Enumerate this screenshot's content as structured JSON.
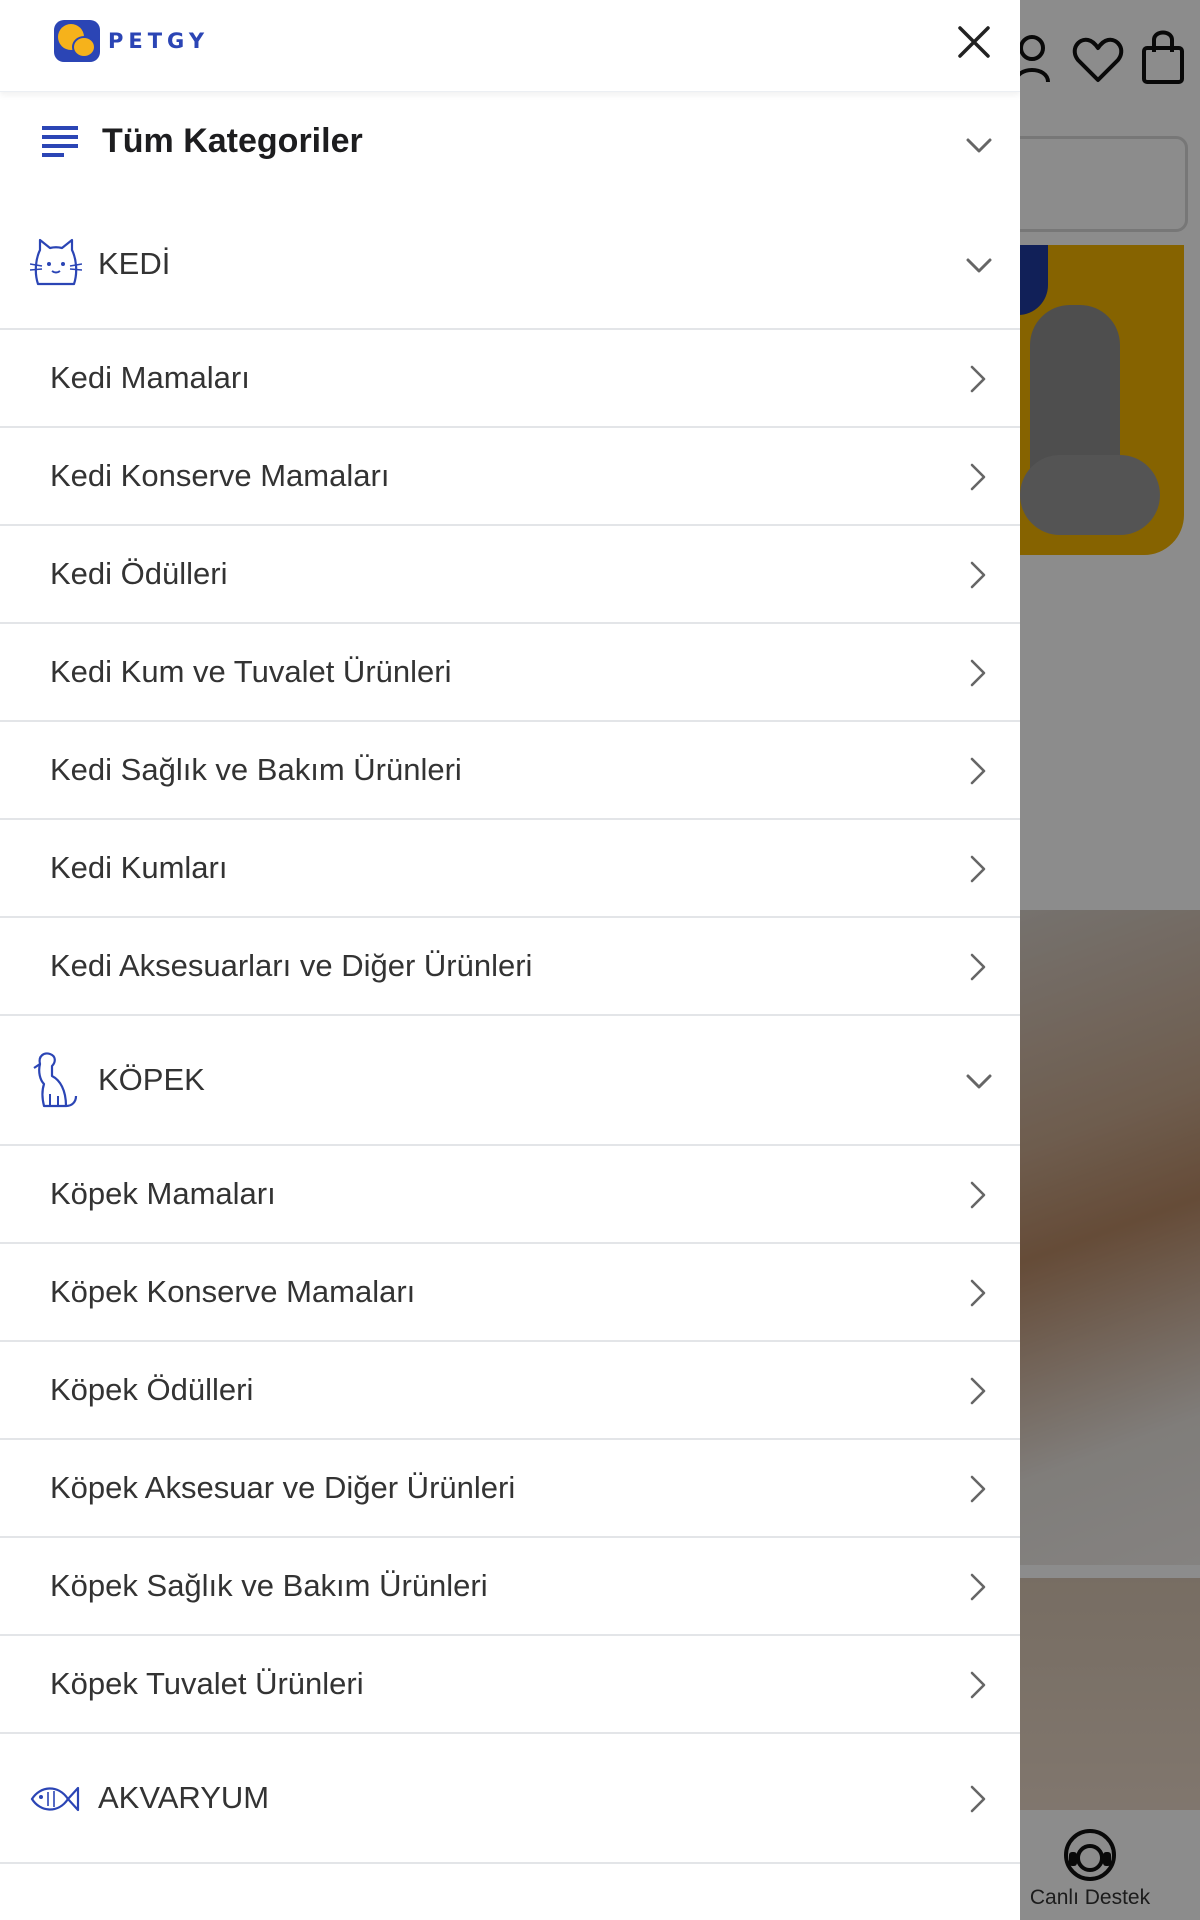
{
  "header": {
    "brand": "PETGY",
    "brand_color": "#2b45b5",
    "accent_color": "#f6b21b"
  },
  "drawer": {
    "all_categories_label": "Tüm Kategoriler",
    "sections": [
      {
        "name": "KEDİ",
        "icon": "cat-icon",
        "expanded": true,
        "items": [
          "Kedi Mamaları",
          "Kedi Konserve Mamaları",
          "Kedi Ödülleri",
          "Kedi Kum ve Tuvalet Ürünleri",
          "Kedi Sağlık ve Bakım Ürünleri",
          "Kedi Kumları",
          "Kedi Aksesuarları ve Diğer Ürünleri"
        ]
      },
      {
        "name": "KÖPEK",
        "icon": "dog-icon",
        "expanded": true,
        "items": [
          "Köpek Mamaları",
          "Köpek Konserve Mamaları",
          "Köpek Ödülleri",
          "Köpek Aksesuar ve Diğer Ürünleri",
          "Köpek Sağlık ve Bakım Ürünleri",
          "Köpek Tuvalet Ürünleri"
        ]
      },
      {
        "name": "AKVARYUM",
        "icon": "fish-icon",
        "expanded": false,
        "items": []
      }
    ]
  },
  "background": {
    "support_label": "Canlı Destek",
    "icons": [
      "user-icon",
      "heart-icon",
      "cart-icon",
      "headset-icon"
    ]
  }
}
